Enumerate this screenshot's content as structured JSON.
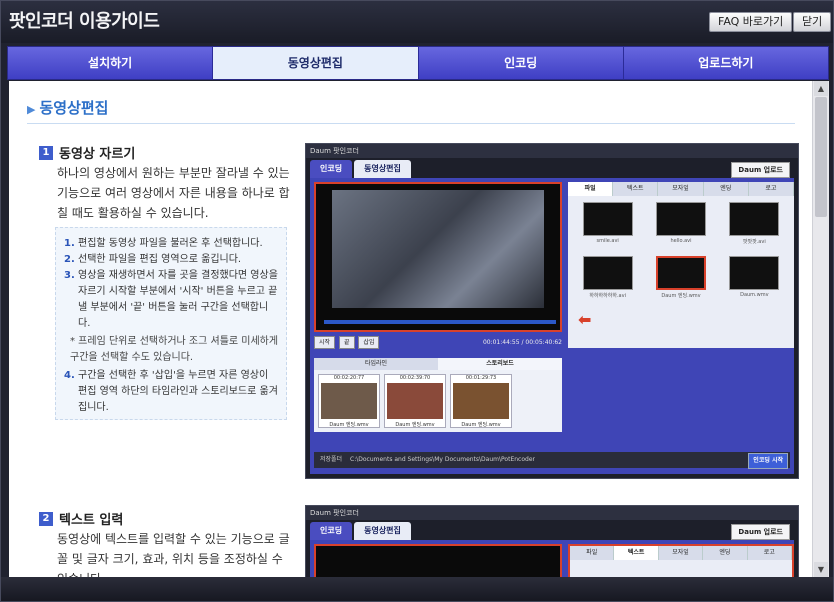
{
  "window": {
    "title": "팟인코더 이용가이드",
    "faq_label": "FAQ 바로가기",
    "close_label": "닫기"
  },
  "tabs": [
    {
      "label": "설치하기"
    },
    {
      "label": "동영상편집"
    },
    {
      "label": "인코딩"
    },
    {
      "label": "업로드하기"
    }
  ],
  "active_tab": 1,
  "section": {
    "title": "동영상편집"
  },
  "step1": {
    "num": "1",
    "title": "동영상 자르기",
    "desc": "하나의 영상에서 원하는 부분만 잘라낼 수 있는 기능으로 여러 영상에서 자른 내용을 하나로 합칠 때도 활용하실 수 있습니다.",
    "notes": [
      {
        "num": "1.",
        "text": "편집할 동영상 파일을 불러온 후 선택합니다."
      },
      {
        "num": "2.",
        "text": "선택한 파일을 편집 영역으로 옮깁니다."
      },
      {
        "num": "3.",
        "text": "영상을 재생하면서 자를 곳을 결정했다면 영상을 자르기 시작할 부분에서 '시작' 버튼을 누르고 끝낼 부분에서 '끝' 버튼을 눌러 구간을 선택합니다."
      }
    ],
    "sub_note": "* 프레임 단위로 선택하거나 조그 셔틀로 미세하게 구간을 선택할 수도 있습니다.",
    "note4": {
      "num": "4.",
      "text": "구간을 선택한 후 '삽입'을 누르면 자른 영상이 편집 영역 하단의 타임라인과 스토리보드로 옮겨집니다."
    }
  },
  "step2": {
    "num": "2",
    "title": "텍스트 입력",
    "desc": "동영상에 텍스트를 입력할 수 있는 기능으로 글꼴 및 글자 크기, 효과, 위치 등을 조정하실 수 있습니다."
  },
  "shot1": {
    "app_title": "Daum 팟인코더",
    "tab_encode": "인코딩",
    "tab_edit": "동영상편집",
    "upload_label": "Daum 업로드",
    "time_text": "00:01:44:55 / 00:05:40:62",
    "btn_start": "시작",
    "btn_end": "끝",
    "btn_insert": "삽입",
    "rp_tabs": [
      "파일",
      "텍스트",
      "모자잎",
      "엔딩",
      "로고"
    ],
    "files": [
      "smile.avi",
      "hello.avi",
      "팟팟팟.avi",
      "하하하하하하.avi",
      "Daum 엔딩.wmv",
      "Daum.wmv"
    ],
    "tl_tabs": [
      "타임라인",
      "스토리보드"
    ],
    "clips": [
      {
        "time": "00:02:20:77",
        "name": "Daum 엔딩.wmv"
      },
      {
        "time": "00:02:39:70",
        "name": "Daum 엔딩.wmv"
      },
      {
        "time": "00:01:29:73",
        "name": "Daum 엔딩.wmv"
      }
    ],
    "save_label": "저장폴더",
    "save_path": "C:\\Documents and Settings\\My Documents\\Daum\\PotEncoder",
    "encode_start": "인코딩 시작"
  },
  "shot2": {
    "app_title": "Daum 팟인코더",
    "tab_encode": "인코딩",
    "tab_edit": "동영상편집",
    "upload_label": "Daum 업로드",
    "rp_tabs": [
      "파일",
      "텍스트",
      "모자잎",
      "엔딩",
      "로고"
    ]
  }
}
